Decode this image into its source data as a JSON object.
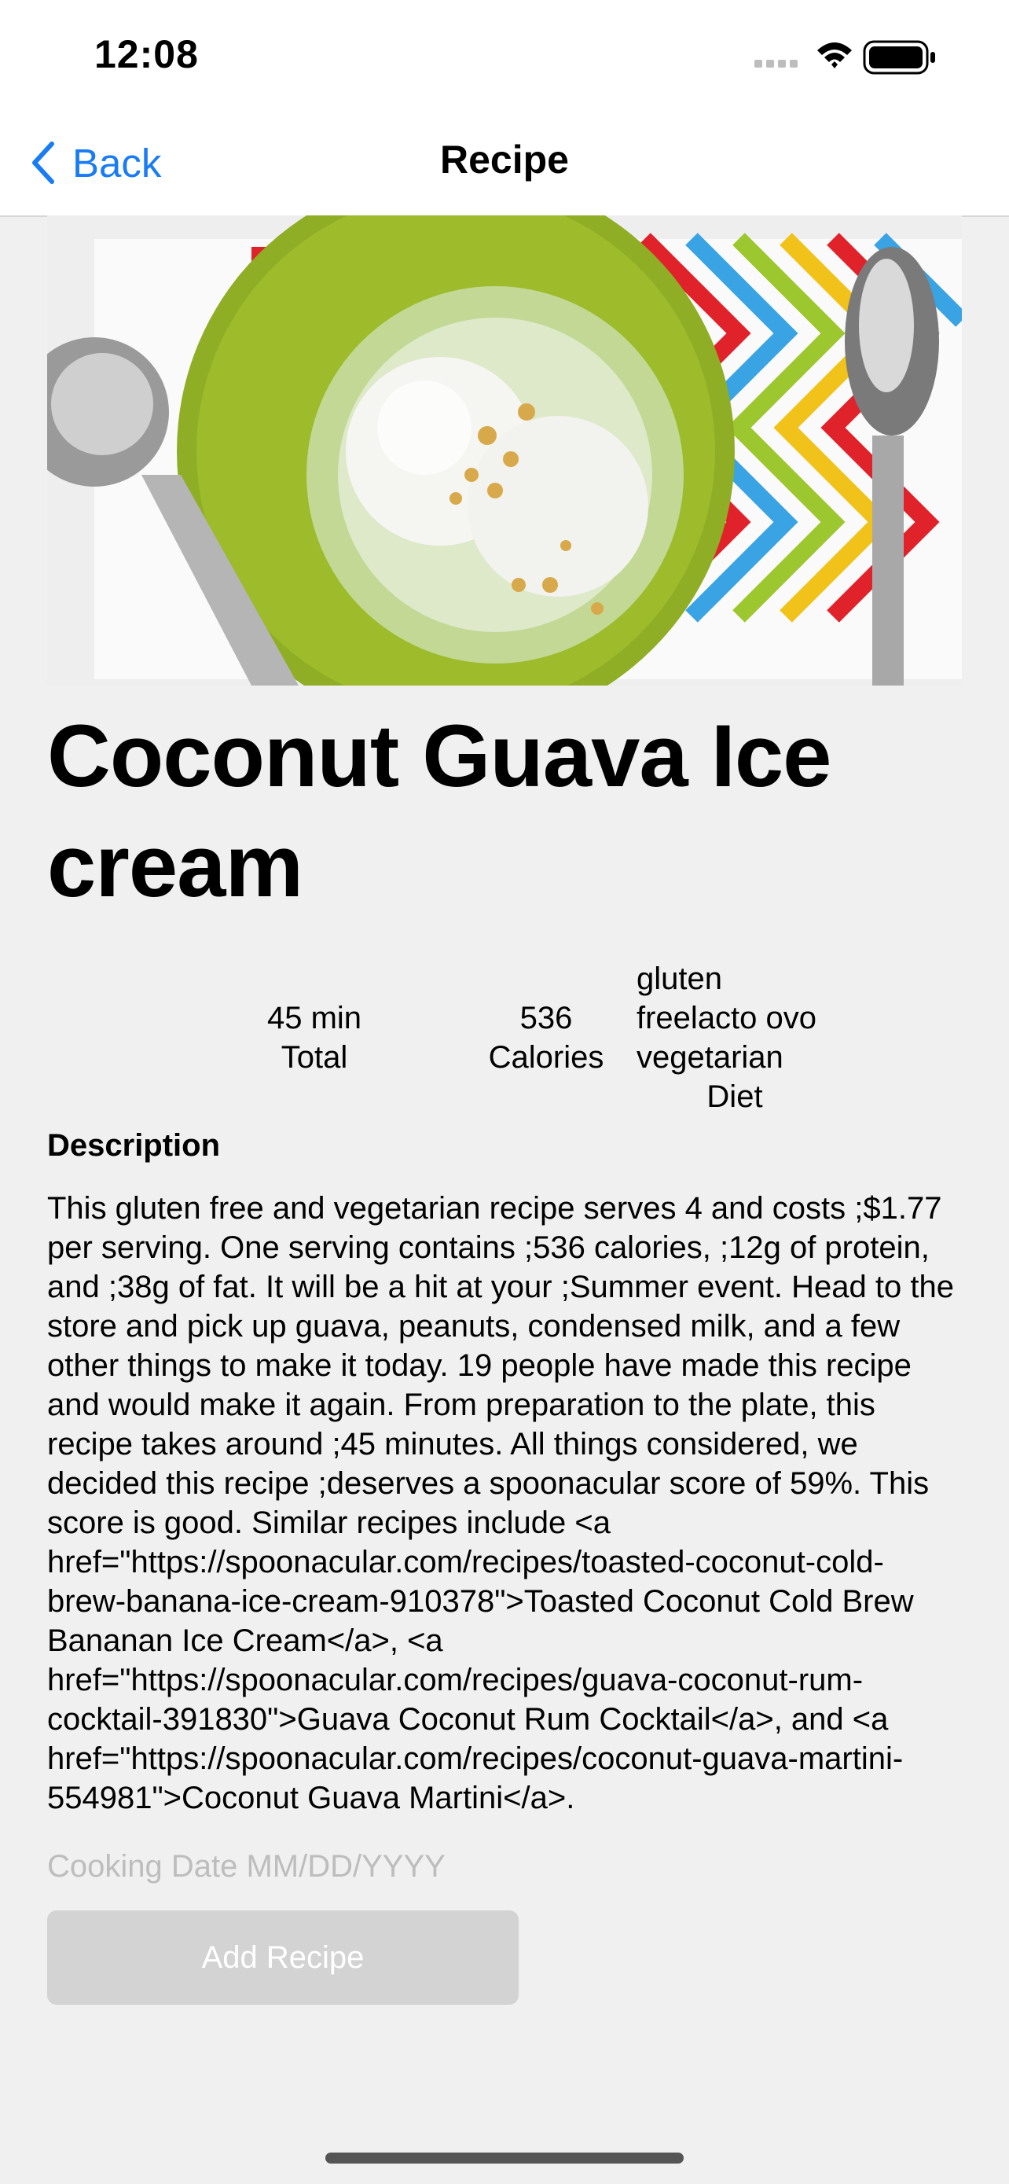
{
  "status_bar": {
    "time": "12:08"
  },
  "nav": {
    "back_label": "Back",
    "title": "Recipe"
  },
  "recipe": {
    "title": "Coconut Guava Ice cream",
    "stats": {
      "time_value": "45 min",
      "time_label": "Total",
      "calories_value": "536",
      "calories_label": "Calories",
      "diet_line1": "gluten",
      "diet_line2": "freelacto ovo",
      "diet_line3": "vegetarian",
      "diet_label": "Diet"
    },
    "description_heading": "Description",
    "description": "This gluten free and vegetarian recipe serves 4 and costs ;$1.77 per serving. One serving contains ;536 calories, ;12g of protein, and ;38g of fat. It will be a hit at your ;Summer event. Head to the store and pick up guava, peanuts, condensed milk, and a few other things to make it today. 19 people have made this recipe and would make it again. From preparation to the plate, this recipe takes around ;45 minutes. All things considered, we decided this recipe ;deserves a spoonacular score of 59%. This score is good. Similar recipes include <a href=\"https://spoonacular.com/recipes/toasted-coconut-cold-brew-banana-ice-cream-910378\">Toasted Coconut Cold Brew Bananan Ice Cream</a>, <a href=\"https://spoonacular.com/recipes/guava-coconut-rum-cocktail-391830\">Guava Coconut Rum Cocktail</a>, and <a href=\"https://spoonacular.com/recipes/coconut-guava-martini-554981\">Coconut Guava Martini</a>."
  },
  "form": {
    "date_placeholder": "Cooking Date MM/DD/YYYY",
    "date_value": "",
    "add_button_label": "Add Recipe"
  },
  "colors": {
    "accent": "#1a7cf2",
    "background": "#f0f0f0",
    "button_disabled": "#d3d3d3"
  }
}
